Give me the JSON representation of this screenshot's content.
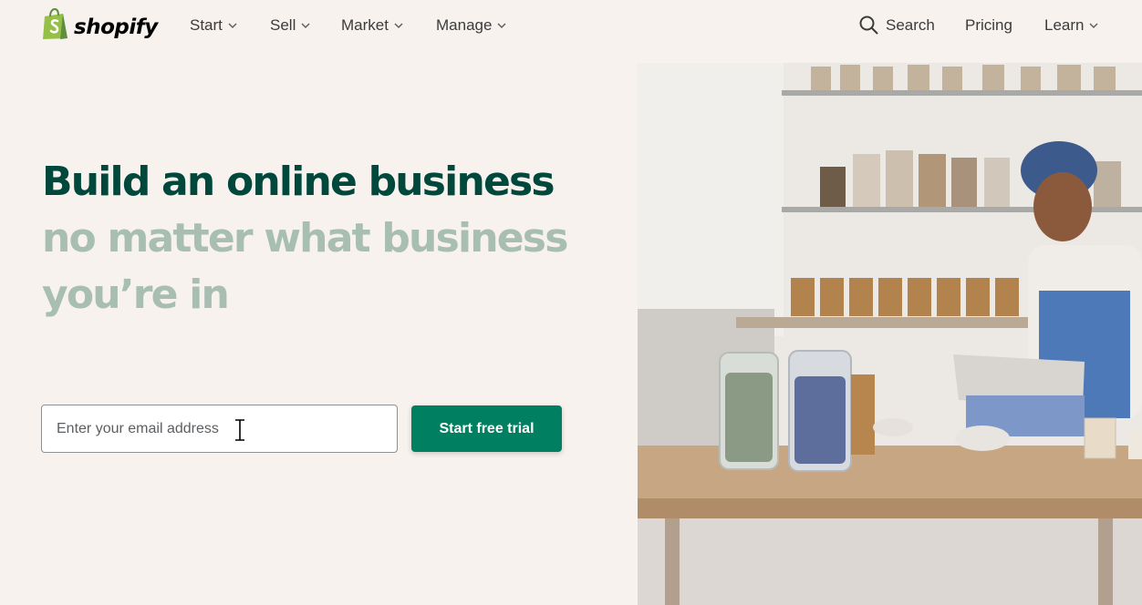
{
  "brand": {
    "name": "shopify"
  },
  "nav": {
    "menus": [
      {
        "label": "Start"
      },
      {
        "label": "Sell"
      },
      {
        "label": "Market"
      },
      {
        "label": "Manage"
      }
    ],
    "search_label": "Search",
    "pricing_label": "Pricing",
    "learn_label": "Learn"
  },
  "hero": {
    "line1": "Build an online business",
    "line2": "no matter what business",
    "line3": "you’re in",
    "email_placeholder": "Enter your email address",
    "cta_label": "Start free trial"
  },
  "colors": {
    "background": "#f7f2ee",
    "headline_dark": "#00483b",
    "headline_muted": "#a8beb2",
    "cta_green": "#008060",
    "logo_green": "#95bf47"
  },
  "icons": [
    "shopify-bag-icon",
    "chevron-down-icon",
    "search-icon",
    "text-cursor-icon"
  ]
}
